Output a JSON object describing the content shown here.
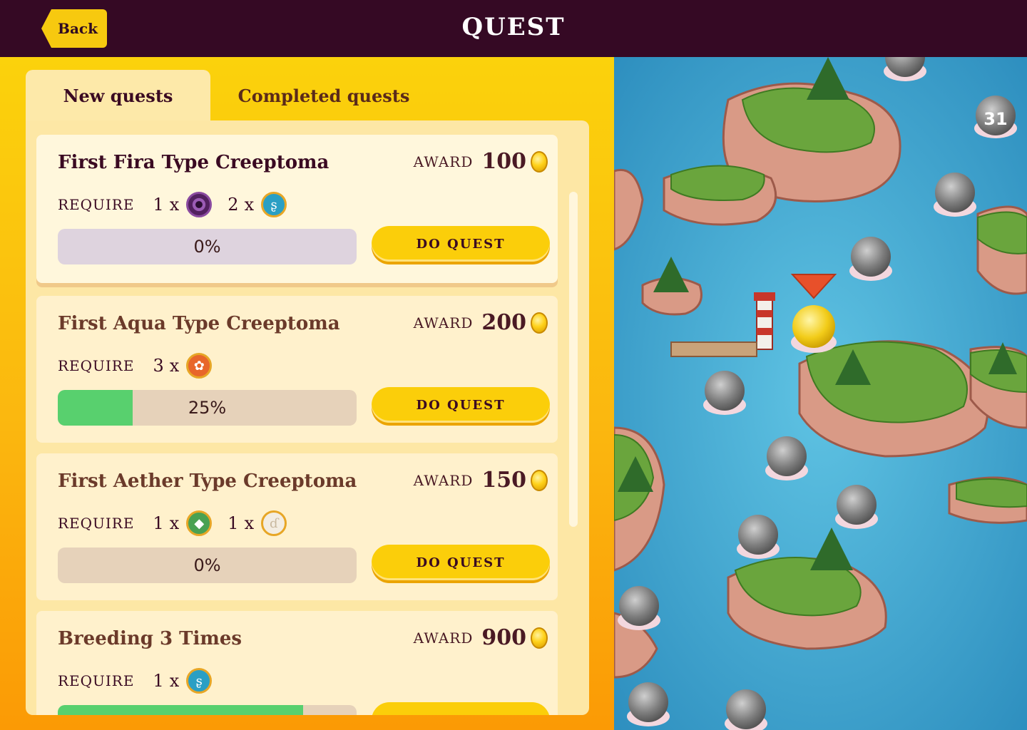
{
  "header": {
    "back_label": "Back",
    "title": "QUEST"
  },
  "tabs": {
    "new": "New quests",
    "completed": "Completed quests"
  },
  "labels": {
    "award": "AWARD",
    "require": "REQUIRE",
    "do_quest": "DO QUEST",
    "times_sign": "x"
  },
  "quests": [
    {
      "title": "First Fira Type Creeptoma",
      "award": "100",
      "progress_text": "0%",
      "progress": 0,
      "requires": [
        {
          "qty": "1",
          "icon": "fira-type-icon"
        },
        {
          "qty": "2",
          "icon": "aqua-type-icon"
        }
      ]
    },
    {
      "title": "First Aqua Type Creeptoma",
      "award": "200",
      "progress_text": "25%",
      "progress": 0.25,
      "requires": [
        {
          "qty": "3",
          "icon": "fire-type-icon"
        }
      ]
    },
    {
      "title": "First Aether Type Creeptoma",
      "award": "150",
      "progress_text": "0%",
      "progress": 0,
      "requires": [
        {
          "qty": "1",
          "icon": "terra-type-icon"
        },
        {
          "qty": "1",
          "icon": "aether-type-icon"
        }
      ]
    },
    {
      "title": "Breeding 3 Times",
      "award": "900",
      "progress_text": "",
      "progress": 0.82,
      "requires": [
        {
          "qty": "1",
          "icon": "aqua-type-icon"
        }
      ]
    }
  ],
  "map": {
    "level_badge": "31"
  },
  "colors": {
    "header_bg": "#350924",
    "accent_yellow": "#fbce0a",
    "progress_green": "#58d06e",
    "water": "#3aa3cf"
  }
}
